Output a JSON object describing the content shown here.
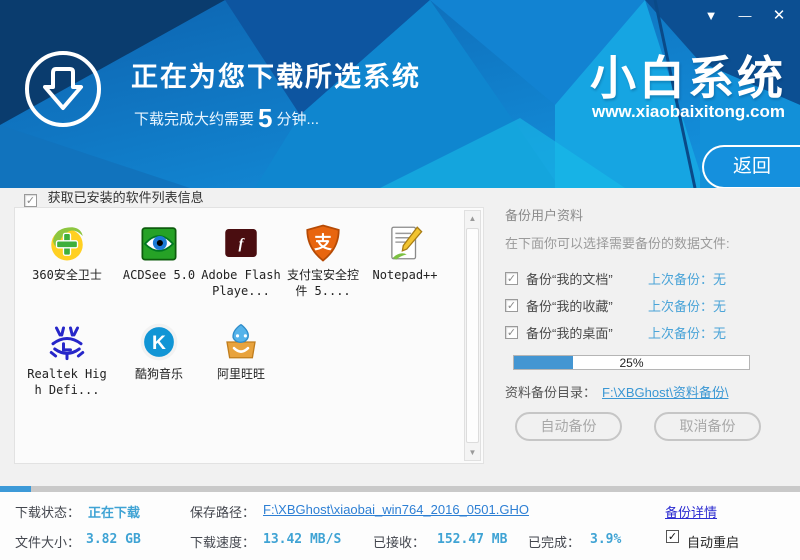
{
  "window": {
    "controls": {
      "menu": "▼",
      "minimize": "—",
      "close": "✕"
    }
  },
  "icons": {
    "check": "✓",
    "scroll_up": "▲",
    "scroll_down": "▼"
  },
  "header": {
    "title": "正在为您下载所选系统",
    "subtitle_prefix": "下载完成大约需要",
    "subtitle_minutes": "5",
    "subtitle_suffix": "分钟...",
    "logo": "小白系统",
    "website": "www.xiaobaixitong.com",
    "back_button": "返回"
  },
  "software_section": {
    "checkbox_label": "获取已安装的软件列表信息",
    "apps": [
      {
        "name": "360安全卫士"
      },
      {
        "name": "ACDSee 5.0"
      },
      {
        "name": "Adobe Flash Playe..."
      },
      {
        "name": "支付宝安全控件 5...."
      },
      {
        "name": "Notepad++"
      },
      {
        "name": "Realtek High Defi..."
      },
      {
        "name": "酷狗音乐"
      },
      {
        "name": "阿里旺旺"
      }
    ]
  },
  "backup_panel": {
    "title": "备份用户资料",
    "description": "在下面你可以选择需要备份的数据文件:",
    "items": [
      {
        "label": "备份“我的文档”",
        "last": "上次备份：无"
      },
      {
        "label": "备份“我的收藏”",
        "last": "上次备份：无"
      },
      {
        "label": "备份“我的桌面”",
        "last": "上次备份：无"
      }
    ],
    "progress_percent": "25%",
    "progress_value": 25,
    "dir_label": "资料备份目录：",
    "dir_link": "F:\\XBGhost\\资料备份\\",
    "auto_button": "自动备份",
    "cancel_button": "取消备份"
  },
  "status_bar": {
    "overall_percent": 3.9,
    "status_label": "下载状态：",
    "status_value": "正在下载",
    "path_label": "保存路径：",
    "path_value": "F:\\XBGhost\\xiaobai_win764_2016_0501.GHO",
    "details_link": "备份详情",
    "size_label": "文件大小：",
    "size_value": "3.82 GB",
    "speed_label": "下载速度：",
    "speed_value": "13.42 MB/S",
    "received_label": "已接收：",
    "received_value": "152.47 MB",
    "done_label": "已完成：",
    "done_value": "3.9%",
    "autorestart_label": "自动重启"
  },
  "colors": {
    "header_base": "#1090dc",
    "accent_blue": "#1590dd",
    "value_cyan": "#3fa3d4",
    "link_blue": "#2d7fd4",
    "details_link": "#2b2bd0",
    "progress_fill": "#4496d2"
  }
}
